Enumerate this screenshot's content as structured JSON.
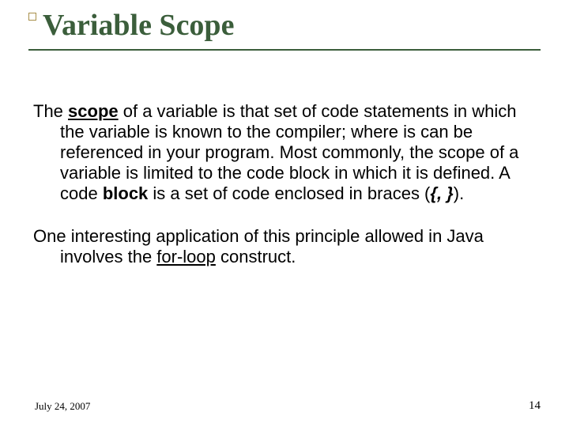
{
  "title": "Variable Scope",
  "body": {
    "p1_a": "The ",
    "p1_scope": "scope",
    "p1_b": " of a variable is that set of code statements in which the variable is known to the compiler; where is can be referenced in your program. Most commonly, the scope of a variable is limited to the code block in which it is defined. A code ",
    "p1_block": "block",
    "p1_c": " is a set of code enclosed in braces (",
    "p1_braces": "{, }",
    "p1_d": ").",
    "p2_a": "One interesting application of this principle allowed in Java involves the ",
    "p2_forloop": "for-loop",
    "p2_b": " construct."
  },
  "footer": {
    "date": "July 24, 2007",
    "page": "14"
  }
}
